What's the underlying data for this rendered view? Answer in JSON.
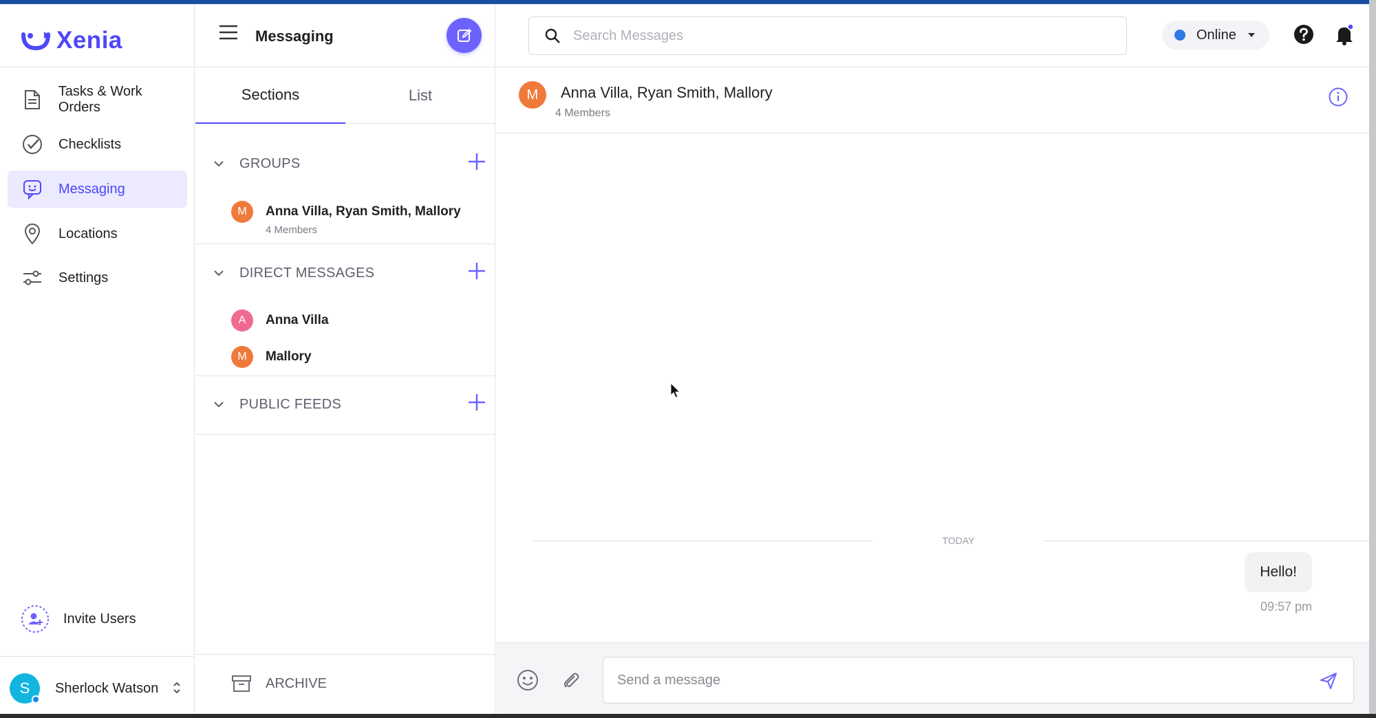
{
  "app": {
    "name": "Xenia",
    "accent": "#4e48fa"
  },
  "nav": {
    "items": [
      {
        "label": "Tasks & Work Orders",
        "icon": "document-icon"
      },
      {
        "label": "Checklists",
        "icon": "check-circle-icon"
      },
      {
        "label": "Messaging",
        "icon": "chat-icon",
        "active": true
      },
      {
        "label": "Locations",
        "icon": "location-pin-icon"
      },
      {
        "label": "Settings",
        "icon": "sliders-icon"
      }
    ],
    "invite_label": "Invite Users",
    "user": {
      "initial": "S",
      "name": "Sherlock Watson"
    }
  },
  "sections_panel": {
    "title": "Messaging",
    "tabs": [
      "Sections",
      "List"
    ],
    "groups_title": "GROUPS",
    "group_items": [
      {
        "initial": "M",
        "name": "Anna Villa, Ryan Smith, Mallory",
        "sub": "4 Members",
        "color": "#f07a3c"
      }
    ],
    "direct_title": "DIRECT MESSAGES",
    "direct_items": [
      {
        "initial": "A",
        "name": "Anna Villa",
        "color": "#f06a8f"
      },
      {
        "initial": "M",
        "name": "Mallory",
        "color": "#f07a3c"
      }
    ],
    "feeds_title": "PUBLIC FEEDS",
    "archive_label": "ARCHIVE"
  },
  "header": {
    "search_placeholder": "Search Messages",
    "status_label": "Online"
  },
  "conversation": {
    "initial": "M",
    "title": "Anna Villa, Ryan Smith, Mallory",
    "subtitle": "4 Members",
    "day_label": "TODAY",
    "messages": [
      {
        "text": "Hello!",
        "time": "09:57 pm"
      }
    ],
    "composer_placeholder": "Send a message"
  }
}
